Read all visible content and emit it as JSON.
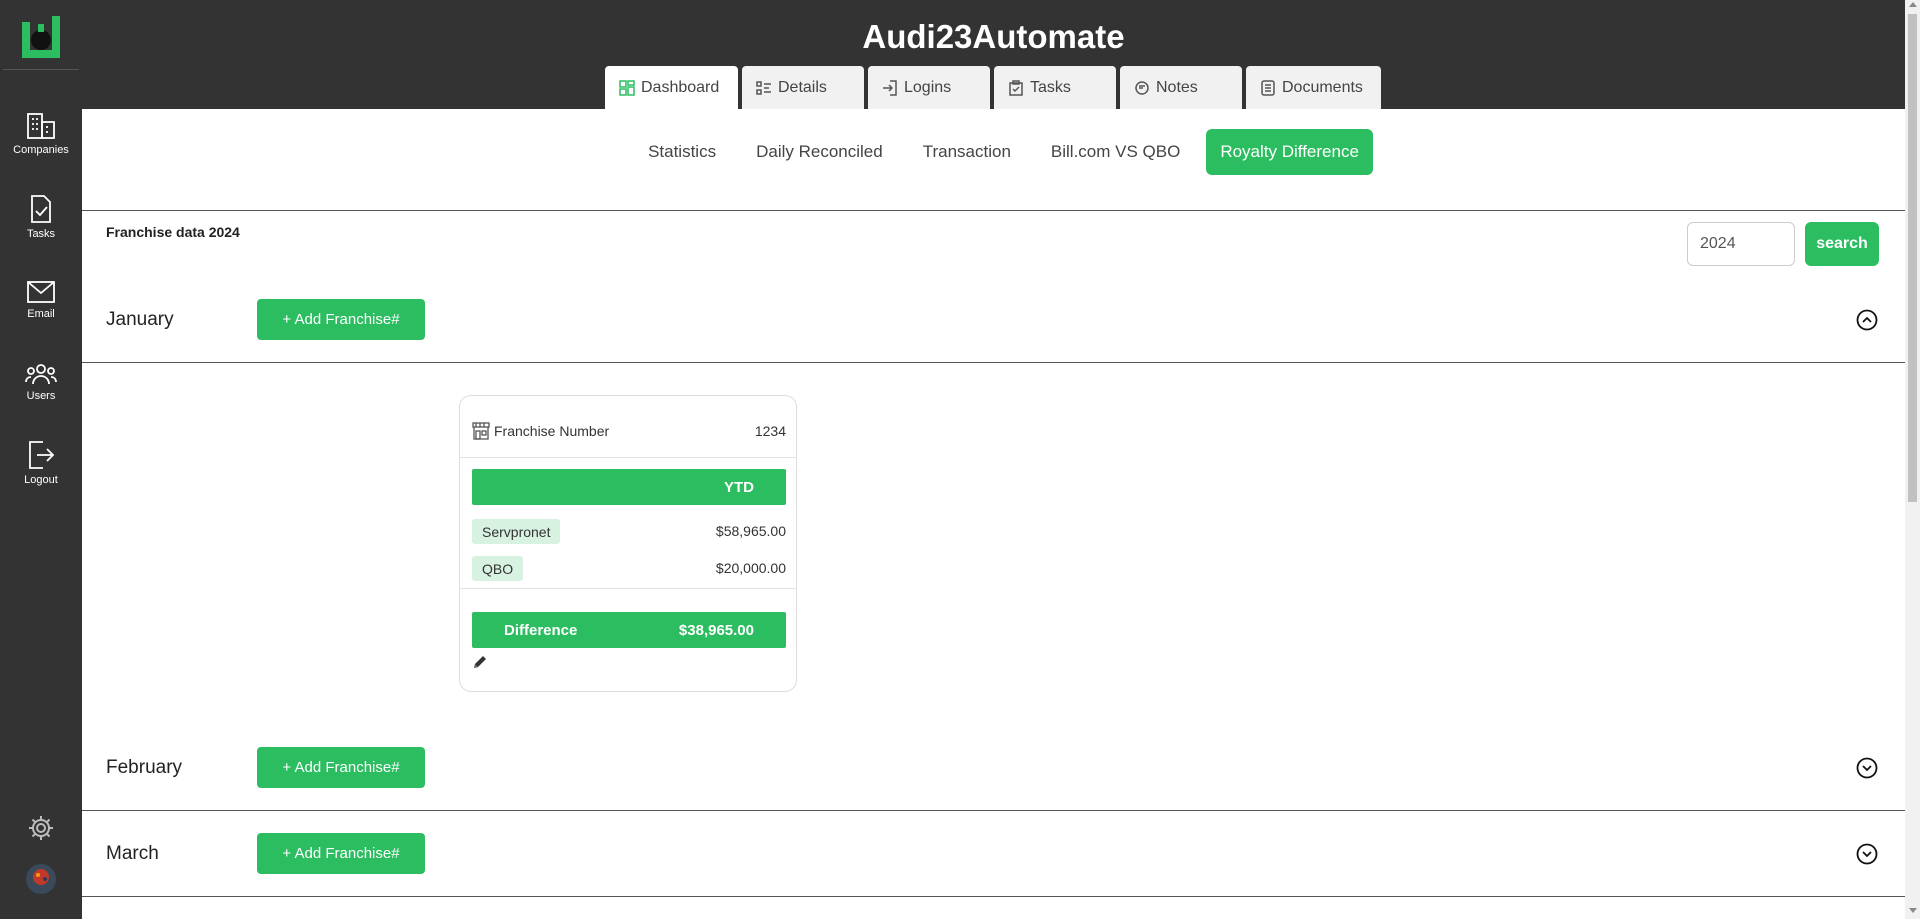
{
  "app": {
    "title": "Audi23Automate"
  },
  "sidebar": {
    "items": [
      {
        "label": "Companies",
        "icon": "building-icon"
      },
      {
        "label": "Tasks",
        "icon": "task-check-icon"
      },
      {
        "label": "Email",
        "icon": "mail-icon"
      },
      {
        "label": "Users",
        "icon": "users-icon"
      },
      {
        "label": "Logout",
        "icon": "logout-icon"
      }
    ]
  },
  "main_tabs": [
    {
      "label": "Dashboard",
      "icon": "dashboard-icon",
      "active": true
    },
    {
      "label": "Details",
      "icon": "details-list-icon"
    },
    {
      "label": "Logins",
      "icon": "login-icon"
    },
    {
      "label": "Tasks",
      "icon": "clipboard-check-icon"
    },
    {
      "label": "Notes",
      "icon": "notes-icon"
    },
    {
      "label": "Documents",
      "icon": "documents-icon"
    }
  ],
  "sub_tabs": [
    {
      "label": "Statistics"
    },
    {
      "label": "Daily Reconciled"
    },
    {
      "label": "Transaction"
    },
    {
      "label": "Bill.com VS QBO"
    },
    {
      "label": "Royalty Difference",
      "active": true
    }
  ],
  "section": {
    "title": "Franchise data 2024"
  },
  "search": {
    "year_value": "2024",
    "button_label": "search"
  },
  "months": [
    {
      "name": "January",
      "add_label": "+ Add Franchise#",
      "expanded": true
    },
    {
      "name": "February",
      "add_label": "+ Add Franchise#",
      "expanded": false
    },
    {
      "name": "March",
      "add_label": "+ Add Franchise#",
      "expanded": false
    }
  ],
  "card": {
    "number_label": "Franchise Number",
    "number_value": "1234",
    "period_label": "YTD",
    "rows": [
      {
        "label": "Servpronet",
        "value": "$58,965.00"
      },
      {
        "label": "QBO",
        "value": "$20,000.00"
      }
    ],
    "difference_label": "Difference",
    "difference_value": "$38,965.00"
  },
  "colors": {
    "accent": "#2bbd60",
    "dark": "#333333",
    "tag_bg": "#d8f2e2"
  }
}
